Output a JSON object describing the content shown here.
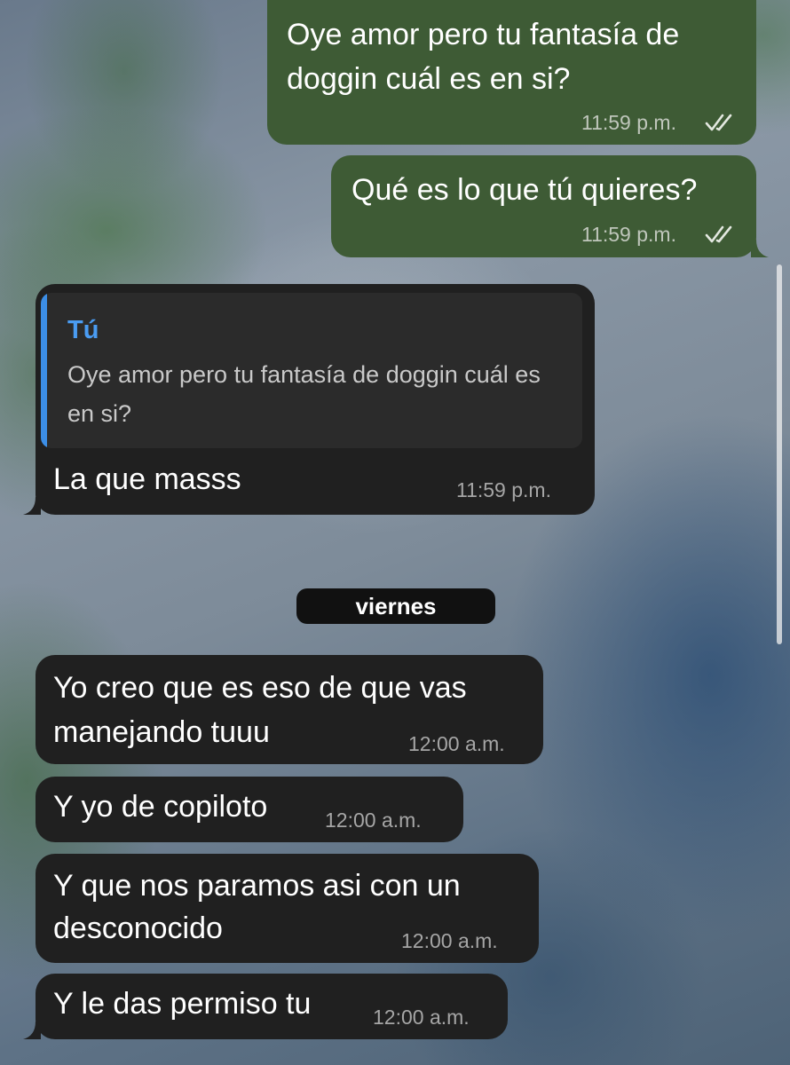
{
  "messages": [
    {
      "direction": "outgoing",
      "lines": [
        "Oye amor pero tu fantasía de",
        "doggin cuál es en si?"
      ],
      "time": "11:59 p.m.",
      "status": "read"
    },
    {
      "direction": "outgoing",
      "lines": [
        "Qué es lo que tú quieres?"
      ],
      "time": "11:59 p.m.",
      "status": "read"
    },
    {
      "direction": "incoming",
      "reply": {
        "author": "Tú",
        "text": "Oye amor pero tu fantasía de doggin cuál es en si?"
      },
      "lines": [
        "La que masss"
      ],
      "time": "11:59 p.m."
    },
    {
      "direction": "incoming",
      "lines": [
        "Yo creo que es eso de que vas",
        "manejando tuuu"
      ],
      "time": "12:00 a.m."
    },
    {
      "direction": "incoming",
      "lines": [
        "Y yo de copiloto"
      ],
      "time": "12:00 a.m."
    },
    {
      "direction": "incoming",
      "lines": [
        "Y que nos paramos asi con un",
        "desconocido"
      ],
      "time": "12:00 a.m."
    },
    {
      "direction": "incoming",
      "lines": [
        "Y le das permiso tu"
      ],
      "time": "12:00 a.m."
    }
  ],
  "date_separator": "viernes",
  "icons": {
    "read_receipt": "double-check-icon"
  },
  "colors": {
    "outgoing_bubble": "#3e5b35",
    "incoming_bubble": "#202020",
    "reply_accent": "#3c8ee6",
    "date_chip": "#111111"
  }
}
